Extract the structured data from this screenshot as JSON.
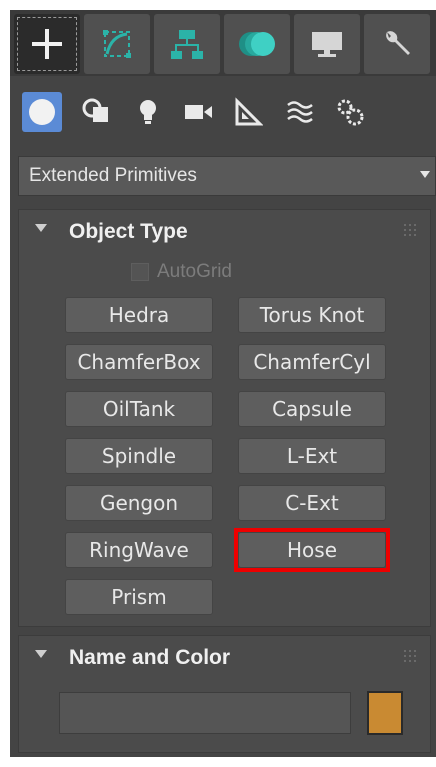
{
  "tabs": [
    {
      "name": "create",
      "icon": "plus-icon",
      "active": true
    },
    {
      "name": "modify",
      "icon": "modify-curve-icon",
      "active": false
    },
    {
      "name": "hierarchy",
      "icon": "hierarchy-icon",
      "active": false
    },
    {
      "name": "motion",
      "icon": "motion-icon",
      "active": false
    },
    {
      "name": "display",
      "icon": "display-monitor-icon",
      "active": false
    },
    {
      "name": "utilities",
      "icon": "wrench-icon",
      "active": false
    }
  ],
  "categories": [
    {
      "name": "geometry",
      "icon": "sphere-icon",
      "active": true
    },
    {
      "name": "shapes",
      "icon": "shapes-icon"
    },
    {
      "name": "lights",
      "icon": "lightbulb-icon"
    },
    {
      "name": "cameras",
      "icon": "camera-icon"
    },
    {
      "name": "helpers",
      "icon": "tape-measure-icon"
    },
    {
      "name": "space-warps",
      "icon": "waves-icon"
    },
    {
      "name": "systems",
      "icon": "gears-icon"
    }
  ],
  "dropdown": {
    "selected": "Extended Primitives"
  },
  "object_type": {
    "title": "Object Type",
    "autogrid_label": "AutoGrid",
    "autogrid_checked": false,
    "buttons": [
      "Hedra",
      "Torus Knot",
      "ChamferBox",
      "ChamferCyl",
      "OilTank",
      "Capsule",
      "Spindle",
      "L-Ext",
      "Gengon",
      "C-Ext",
      "RingWave",
      "Hose",
      "Prism"
    ],
    "highlighted": "Hose"
  },
  "name_color": {
    "title": "Name and Color",
    "name_value": "",
    "swatch_color": "#c98a32"
  },
  "colors": {
    "accent": "#5b8bd6",
    "highlight": "#ee0000"
  }
}
